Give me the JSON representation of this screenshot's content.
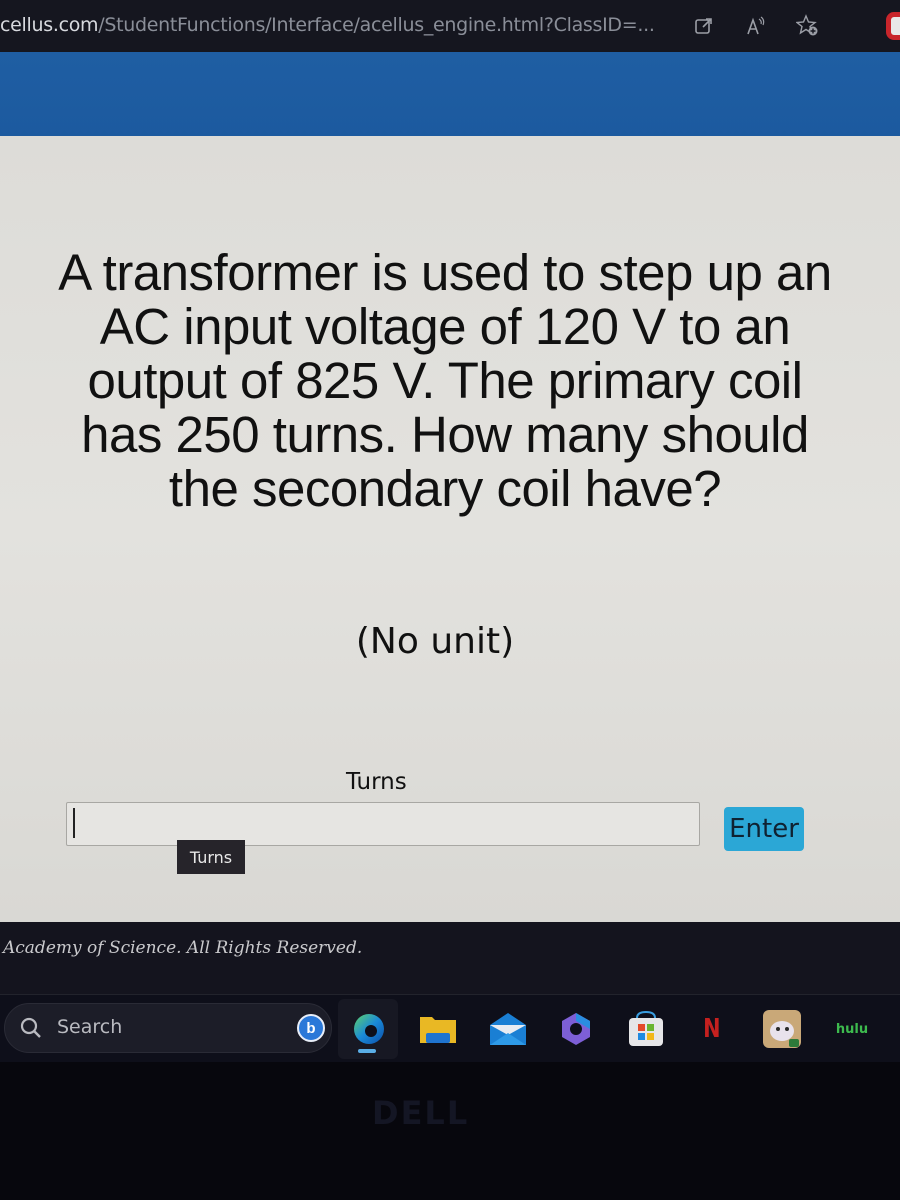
{
  "browser": {
    "url_host": "cellus.com",
    "url_path": "/StudentFunctions/Interface/acellus_engine.html?ClassID=...",
    "icons": [
      "open-in-app-icon",
      "read-aloud-icon",
      "add-favorite-icon",
      "extension-icon"
    ]
  },
  "question": {
    "text": "A transformer is used to step up an AC input voltage of 120 V to an output of 825 V.  The primary coil has 250 turns.  How many should the secondary coil have?",
    "lines": [
      "A transformer is used to step up an",
      "AC input voltage of 120 V to an",
      "output of 825 V.  The primary coil",
      "has 250 turns.  How many should",
      "the secondary coil have?"
    ],
    "unit_hint": "(No unit)"
  },
  "answer": {
    "label": "Turns",
    "value": "",
    "placeholder": "",
    "tooltip": "Turns",
    "enter_label": "Enter"
  },
  "colors": {
    "header_blue": "#1f5ea3",
    "enter_button": "#2ba7d6",
    "content_bg": "#dddcd8"
  },
  "footer": {
    "copyright": "Academy of Science.  All Rights Reserved."
  },
  "taskbar": {
    "search_label": "Search",
    "apps": [
      {
        "name": "edge",
        "active": true
      },
      {
        "name": "file-explorer"
      },
      {
        "name": "mail"
      },
      {
        "name": "microsoft-365"
      },
      {
        "name": "microsoft-store"
      },
      {
        "name": "netflix",
        "label": "N"
      },
      {
        "name": "game-app"
      },
      {
        "name": "hulu",
        "label": "hulu"
      }
    ]
  },
  "bezel": {
    "brand": "DELL"
  }
}
